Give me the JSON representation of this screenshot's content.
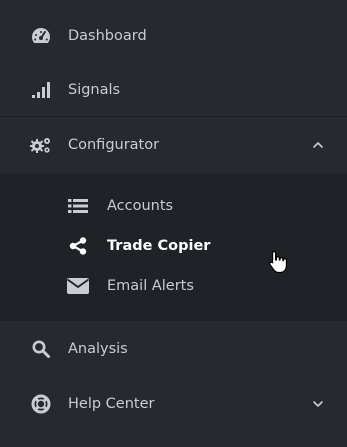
{
  "nav": {
    "dashboard": {
      "label": "Dashboard",
      "icon": "tachometer-icon"
    },
    "signals": {
      "label": "Signals",
      "icon": "signal-bars-icon"
    },
    "configurator": {
      "label": "Configurator",
      "icon": "gears-icon",
      "expanded": true,
      "children": [
        {
          "label": "Accounts",
          "icon": "list-icon"
        },
        {
          "label": "Trade Copier",
          "icon": "share-icon",
          "active": true
        },
        {
          "label": "Email Alerts",
          "icon": "envelope-icon"
        }
      ]
    },
    "analysis": {
      "label": "Analysis",
      "icon": "search-icon"
    },
    "help_center": {
      "label": "Help Center",
      "icon": "life-ring-icon",
      "expanded": false
    }
  },
  "colors": {
    "background": "#262a2f",
    "submenu_background": "#1f2226",
    "text": "#c9ccd1",
    "active_text": "#ffffff"
  }
}
